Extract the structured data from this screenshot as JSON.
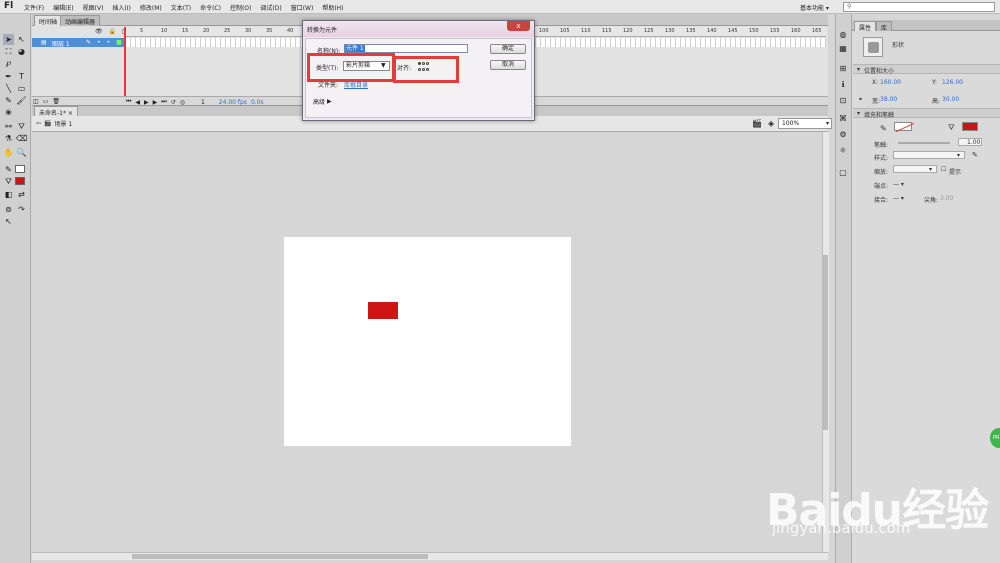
{
  "app": {
    "logo": "Fl",
    "menu": [
      "文件(F)",
      "编辑(E)",
      "视图(V)",
      "插入(I)",
      "修改(M)",
      "文本(T)",
      "命令(C)",
      "控制(O)",
      "调试(D)",
      "窗口(W)",
      "帮助(H)"
    ],
    "workspace": "基本功能",
    "search_placeholder": ""
  },
  "timeline": {
    "tabs": [
      "时间轴",
      "动画编辑器"
    ],
    "layer_name": "图层 1",
    "ticks": [
      "5",
      "10",
      "15",
      "20",
      "25",
      "30",
      "35",
      "40",
      "45",
      "50",
      "55",
      "60",
      "65",
      "70",
      "75",
      "80",
      "85",
      "90",
      "95",
      "100",
      "105",
      "110",
      "115",
      "120",
      "125",
      "130",
      "135",
      "140",
      "145",
      "150",
      "155",
      "160",
      "165"
    ],
    "fps": "24.00 fps",
    "time": "0.0s",
    "frame": "1"
  },
  "document": {
    "tab": "未命名-1*",
    "scene": "场景 1",
    "zoom": "100%"
  },
  "dialog": {
    "title": "转换为元件",
    "name_label": "名称(N):",
    "name_value": "元件 1",
    "type_label": "类型(T):",
    "type_value": "影片剪辑",
    "align_label": "对齐:",
    "folder_label": "文件夹:",
    "folder_value": "库根目录",
    "advanced_label": "高级",
    "ok": "确定",
    "cancel": "取消",
    "close": "x"
  },
  "properties": {
    "tabs": [
      "属性",
      "库"
    ],
    "object_type": "形状",
    "section_pos": "位置和大小",
    "x_label": "X:",
    "x_value": "160.00",
    "y_label": "Y:",
    "y_value": "126.00",
    "w_label": "宽:",
    "w_value": "38.00",
    "h_label": "高:",
    "h_value": "30.00",
    "section_fill": "填充和笔触",
    "stroke_label": "笔触:",
    "stroke_value": "1.00",
    "style_label": "样式:",
    "scale_label": "缩放:",
    "hint_label": "提示",
    "cap_label": "端点:",
    "join_label": "接合:",
    "miter_label": "尖角:",
    "miter_value": "3.00",
    "fill_color": "#cc1616"
  },
  "watermark": {
    "brand": "Baidu经验",
    "url": "jingyan.baidu.com"
  }
}
